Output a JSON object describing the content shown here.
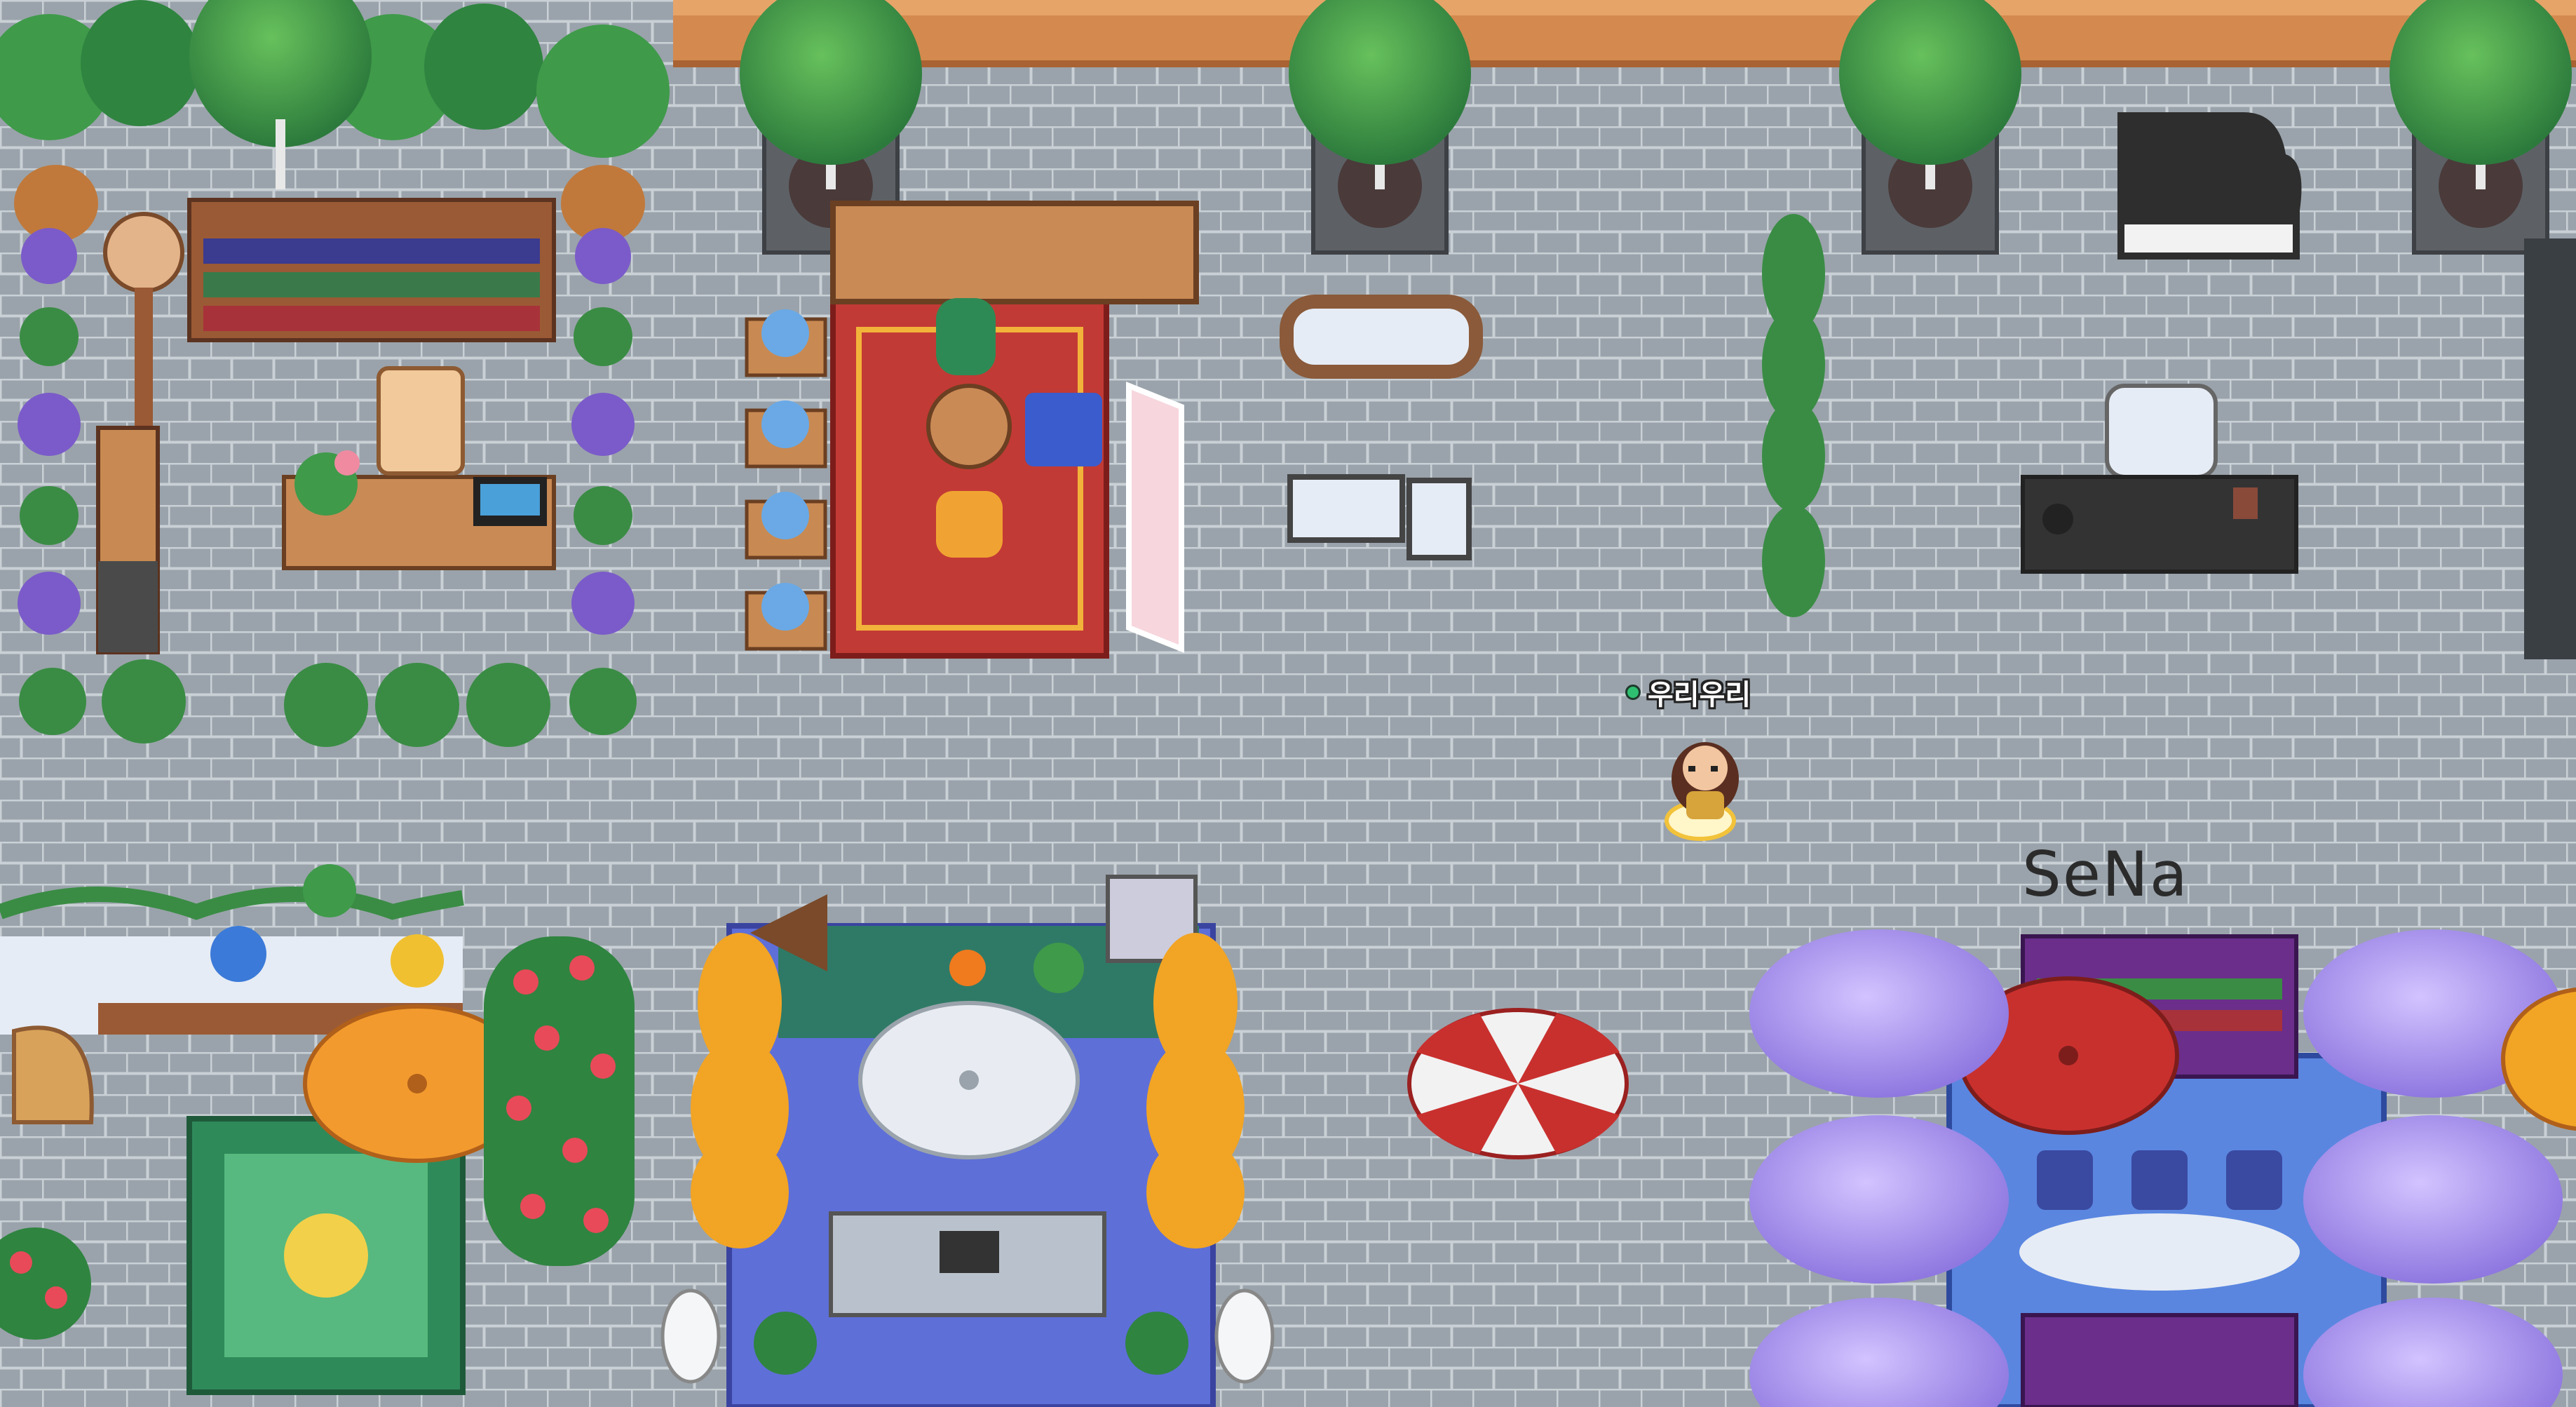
{
  "game": {
    "player": {
      "name": "우리우리",
      "status": "online",
      "status_color": "#2fbf71"
    },
    "room_sign": "SeNa"
  },
  "colors": {
    "floor": "#9aa3ab",
    "floor_line": "#c9d0d6",
    "wall": "#d48a4e",
    "tree_green": "#3f9a4a",
    "wisteria": "#b9a4ef",
    "red_rug": "#c23a35",
    "blue_rug": "#5e6fd8",
    "green_rug": "#2f8a5a"
  }
}
